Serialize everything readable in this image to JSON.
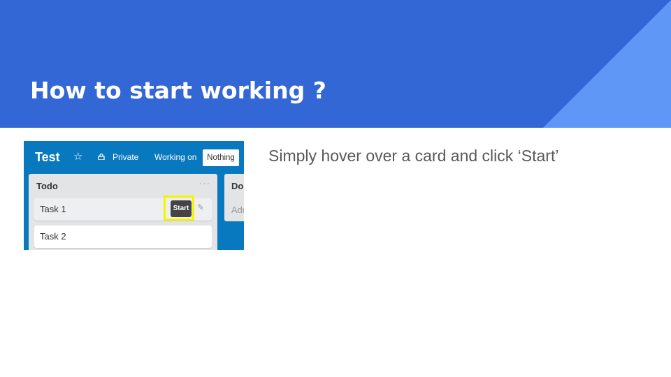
{
  "slide": {
    "title": "How to start working ?",
    "body_text": "Simply hover over a card and click ‘Start’",
    "colors": {
      "header": "#3367d6",
      "header_accent": "#5e97f6",
      "board_bg": "#0979bf",
      "highlight": "#f5f500"
    }
  },
  "screenshot": {
    "board_name": "Test",
    "star_icon": "star-icon",
    "lock_icon": "lock-icon",
    "privacy_label": "Private",
    "working_on_label": "Working on",
    "working_on_value": "Nothing",
    "lists": [
      {
        "title": "Todo",
        "menu": "···",
        "cards": [
          {
            "label": "Task 1",
            "hover_button": "Start",
            "edit_icon": "✎"
          },
          {
            "label": "Task 2"
          }
        ]
      },
      {
        "title": "Do",
        "add_card": "Add"
      }
    ]
  }
}
